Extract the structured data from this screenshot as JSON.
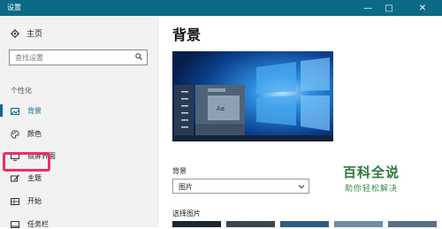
{
  "window": {
    "title": "设置",
    "minimize": "—",
    "maximize": "□",
    "close": "✕"
  },
  "sidebar": {
    "home_label": "主页",
    "home_icon": "gear-icon",
    "search_placeholder": "查找设置",
    "search_icon": "search-icon",
    "section_title": "个性化",
    "items": [
      {
        "label": "背景",
        "icon": "picture-icon",
        "selected": true
      },
      {
        "label": "颜色",
        "icon": "palette-icon",
        "selected": false
      },
      {
        "label": "锁屏界面",
        "icon": "monitor-icon",
        "selected": false
      },
      {
        "label": "主题",
        "icon": "theme-brush-icon",
        "selected": false,
        "highlighted": true
      },
      {
        "label": "开始",
        "icon": "start-grid-icon",
        "selected": false
      },
      {
        "label": "任务栏",
        "icon": "taskbar-icon",
        "selected": false
      }
    ]
  },
  "main": {
    "title": "背景",
    "preview": {
      "sample_text": "Aa"
    },
    "background_label": "背景",
    "background_value": "图片",
    "choose_picture_label": "选择图片"
  },
  "watermark": {
    "brand": "百科全说",
    "tagline": "助你轻松解决"
  },
  "colors": {
    "accent": "#0d6a87",
    "highlight_border": "#ec2f64",
    "watermark": "#2e7a3a"
  }
}
